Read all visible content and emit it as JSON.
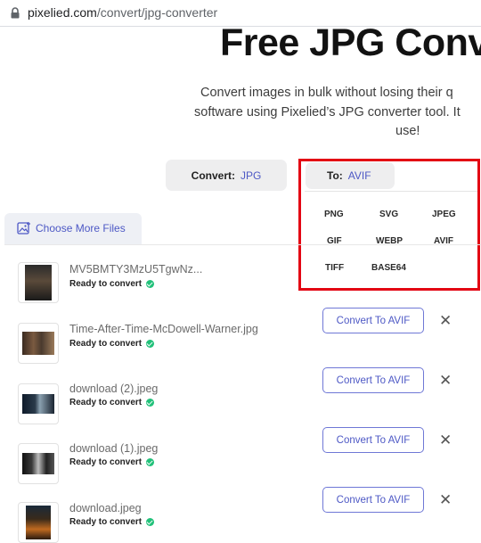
{
  "browser": {
    "url_domain": "pixelied.com",
    "url_path": "/convert/jpg-converter"
  },
  "hero": {
    "title": "Free JPG Conv",
    "subtitle_line1": "Convert images in bulk without losing their q",
    "subtitle_line2": "software using Pixelied’s JPG converter tool. It",
    "subtitle_line3": "use!"
  },
  "converter": {
    "convert_label": "Convert:",
    "convert_value": "JPG",
    "to_label": "To:",
    "to_value": "AVIF",
    "formats": [
      "PNG",
      "SVG",
      "JPEG",
      "GIF",
      "WEBP",
      "AVIF",
      "TIFF",
      "BASE64"
    ]
  },
  "upload": {
    "choose_more_label": "Choose More Files"
  },
  "files": [
    {
      "name": "MV5BMTY3MzU5TgwNz...",
      "status": "Ready to convert",
      "button": ""
    },
    {
      "name": "Time-After-Time-McDowell-Warner.jpg",
      "status": "Ready to convert",
      "button": "Convert To AVIF"
    },
    {
      "name": "download (2).jpeg",
      "status": "Ready to convert",
      "button": "Convert To AVIF"
    },
    {
      "name": "download (1).jpeg",
      "status": "Ready to convert",
      "button": "Convert To AVIF"
    },
    {
      "name": "download.jpeg",
      "status": "Ready to convert",
      "button": "Convert To AVIF"
    }
  ],
  "icons": {
    "lock": "lock-icon",
    "image_upload": "image-upload-icon",
    "check": "check-circle-icon",
    "close": "close-icon"
  },
  "colors": {
    "accent": "#4d58c5",
    "highlight_border": "#e30613",
    "success": "#22c17a"
  }
}
